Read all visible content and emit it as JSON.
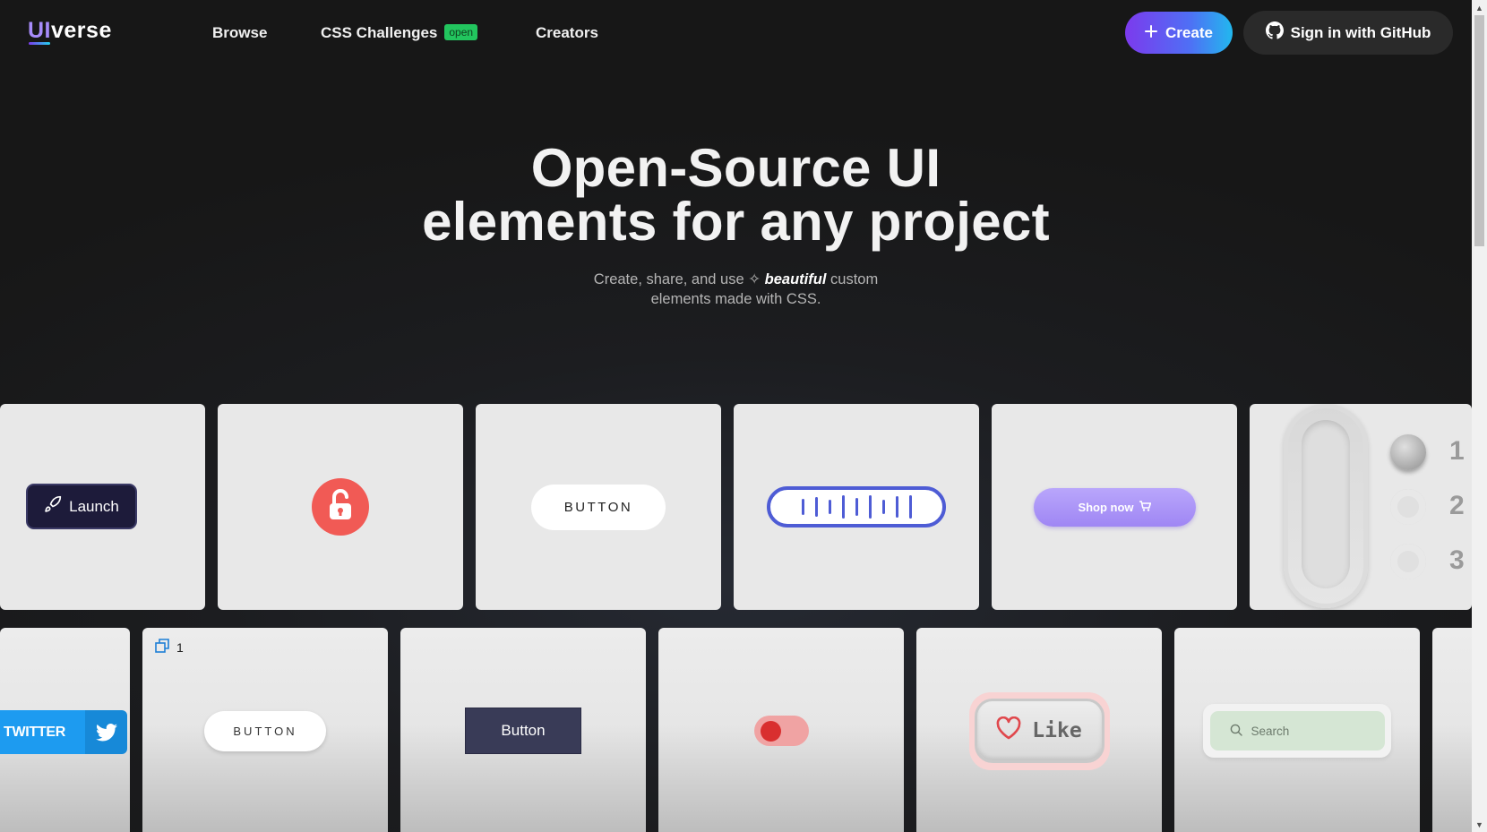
{
  "header": {
    "logo_ui": "UI",
    "logo_rest": "verse",
    "nav": [
      "Browse",
      "CSS Challenges",
      "Creators"
    ],
    "challenges_badge": "open",
    "create_label": "Create",
    "github_label": "Sign in with GitHub"
  },
  "hero": {
    "title_line1": "Open-Source UI",
    "title_line2": "elements for any project",
    "sub_before": "Create, share, and use",
    "sub_em": "beautiful",
    "sub_after": "custom",
    "sub_line2": "elements made with CSS."
  },
  "row1": {
    "launch_label": "Launch",
    "button_label": "BUTTON",
    "shop_label": "Shop now",
    "knob_numbers": [
      "1",
      "2",
      "3"
    ]
  },
  "row2": {
    "twitter_label": "TWITTER",
    "copy_count": "1",
    "button_label": "BUTTON",
    "dark_button_label": "Button",
    "like_label": "Like",
    "search_placeholder": "Search"
  },
  "colors": {
    "accent_start": "#7c3aed",
    "accent_end": "#22b8ee",
    "badge_green": "#22c55e",
    "twitter_blue": "#1d9bf0"
  }
}
